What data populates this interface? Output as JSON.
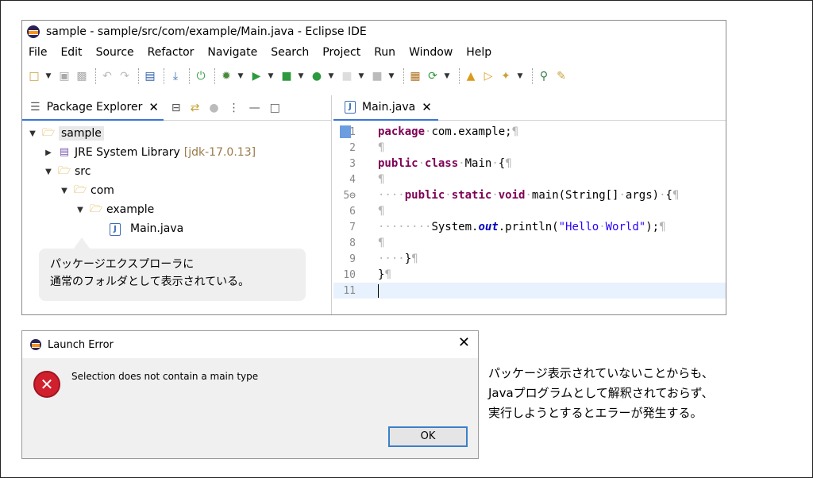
{
  "window": {
    "title": "sample - sample/src/com/example/Main.java - Eclipse IDE"
  },
  "menu": [
    "File",
    "Edit",
    "Source",
    "Refactor",
    "Navigate",
    "Search",
    "Project",
    "Run",
    "Window",
    "Help"
  ],
  "package_explorer": {
    "tab_label": "Package Explorer",
    "project": "sample",
    "jre_label": "JRE System Library",
    "jre_version": "[jdk-17.0.13]",
    "src": "src",
    "com": "com",
    "example": "example",
    "file": "Main.java"
  },
  "callout": {
    "line1": "パッケージエクスプローラに",
    "line2": "通常のフォルダとして表示されている。"
  },
  "editor": {
    "tab_label": "Main.java",
    "line_numbers": [
      "1",
      "2",
      "3",
      "4",
      "5",
      "6",
      "7",
      "8",
      "9",
      "10",
      "11"
    ]
  },
  "dialog": {
    "title": "Launch Error",
    "message": "Selection does not contain a main type",
    "ok_label": "OK"
  },
  "note": {
    "line1": "パッケージ表示されていないことからも、",
    "line2": "Javaプログラムとして解釈されておらず、",
    "line3": "実行しようとするとエラーが発生する。"
  }
}
